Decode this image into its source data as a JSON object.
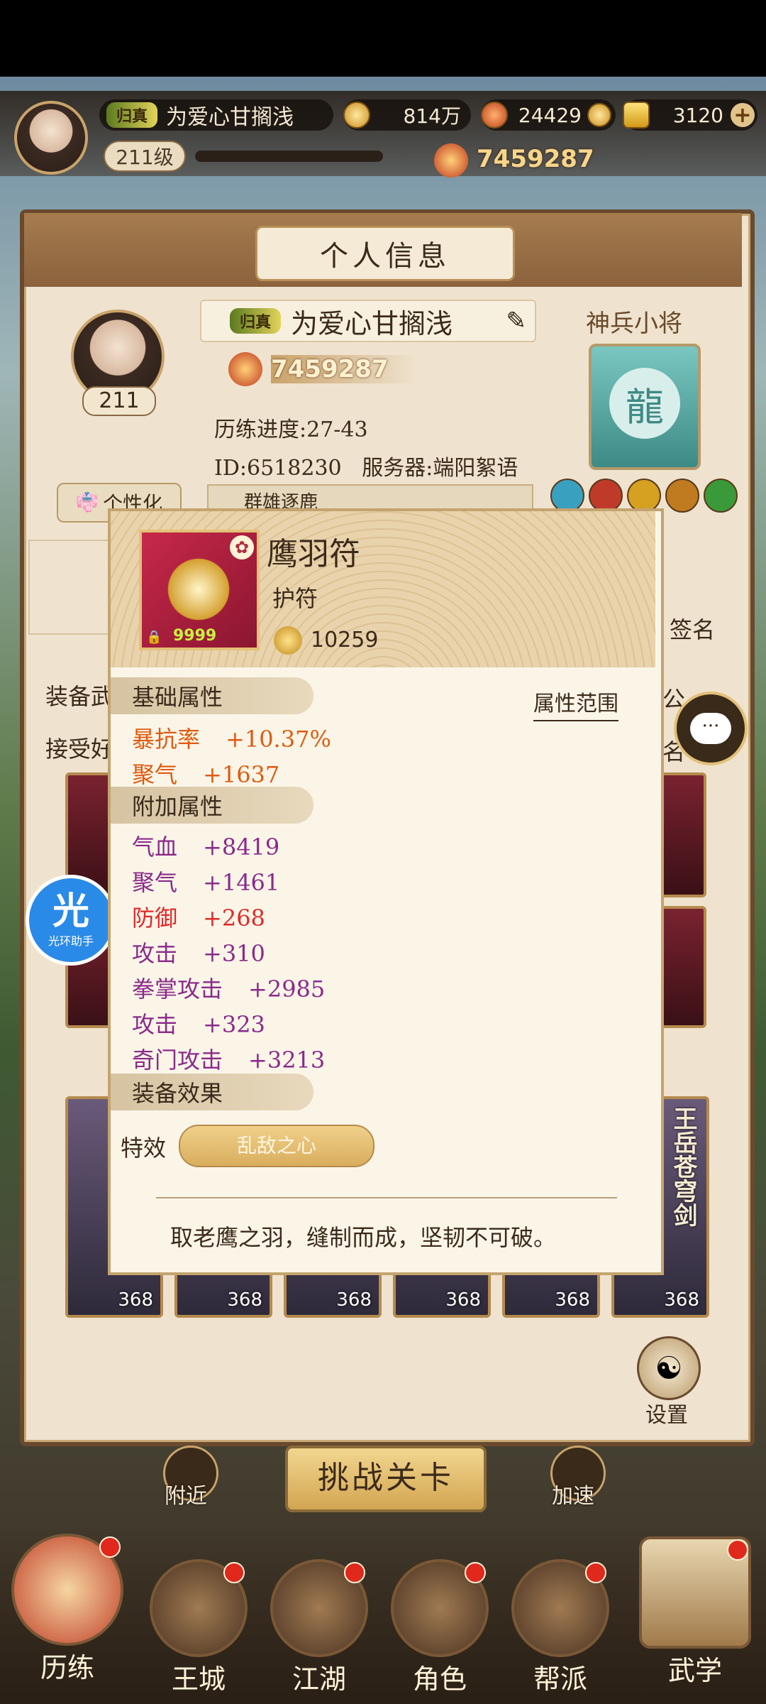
{
  "header": {
    "vip_badge": "归真",
    "player_name": "为爱心甘搁浅",
    "level": "211级",
    "coins": "814万",
    "jade": "24429",
    "gold": "3120",
    "power": "7459287"
  },
  "panel": {
    "title": "个人信息",
    "vip_badge": "归真",
    "player_name": "为爱心甘搁浅",
    "avatar_level": "211",
    "power": "7459287",
    "progress": "历练进度:27-43",
    "id_server": "ID:6518230   服务器:端阳絮语",
    "personalize": "个性化",
    "group": "群雄逐鹿",
    "right_title": "神兵小将",
    "signature": "签名",
    "left_line1": "装备武",
    "left_line2": "接受好",
    "right_side1": "公",
    "right_side2": "名",
    "settings": "设置"
  },
  "hero_cards": {
    "levels": [
      "368",
      "368",
      "368",
      "368",
      "368",
      "368"
    ],
    "card6_title": "王岳苍穹剑"
  },
  "item_popup": {
    "name": "鹰羽符",
    "type": "护符",
    "quantity": "9999",
    "score": "10259",
    "base_tab": "基础属性",
    "range_link": "属性范围",
    "base_stats": [
      {
        "label": "暴抗率",
        "value": "+10.37%"
      },
      {
        "label": "聚气",
        "value": "+1637"
      }
    ],
    "extra_tab": "附加属性",
    "extra_stats": [
      {
        "label": "气血",
        "value": "+8419"
      },
      {
        "label": "聚气",
        "value": "+1461"
      },
      {
        "label": "防御",
        "value": "+268"
      },
      {
        "label": "攻击",
        "value": "+310"
      },
      {
        "label": "拳掌攻击",
        "value": "+2985"
      },
      {
        "label": "攻击",
        "value": "+323"
      },
      {
        "label": "奇门攻击",
        "value": "+3213"
      }
    ],
    "effect_tab": "装备效果",
    "effect_label": "特效",
    "effect_name": "乱敌之心",
    "description": "取老鹰之羽，缝制而成，坚韧不可破。"
  },
  "floating": {
    "assistant_big": "光",
    "assistant_small": "光环助手"
  },
  "bottom": {
    "nearby": "附近",
    "challenge": "挑战关卡",
    "speedup": "加速",
    "nav": [
      "历练",
      "王城",
      "江湖",
      "角色",
      "帮派",
      "武学"
    ]
  },
  "colors": {
    "stat_purple": "#8a2a8a",
    "stat_orange": "#e05a10",
    "stat_red": "#e02a2a",
    "panel_bg": "#efe3cf"
  }
}
